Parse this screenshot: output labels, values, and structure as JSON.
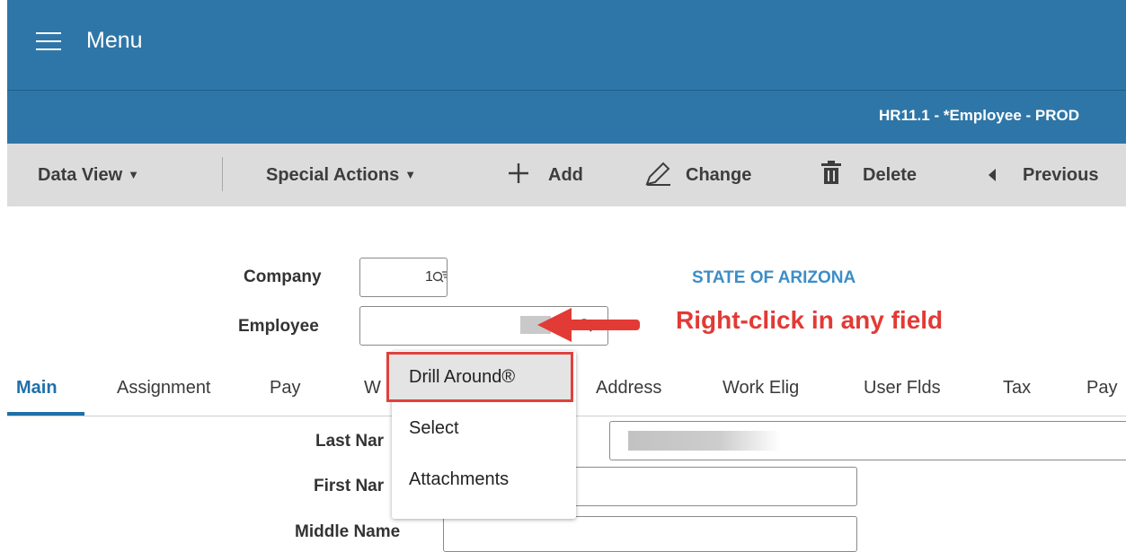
{
  "header": {
    "menu_label": "Menu"
  },
  "subheader": {
    "title": "HR11.1 - *Employee - PROD"
  },
  "toolbar": {
    "data_view": "Data View",
    "special_actions": "Special Actions",
    "add": "Add",
    "change": "Change",
    "delete": "Delete",
    "previous": "Previous"
  },
  "form": {
    "company_label": "Company",
    "company_value": "1",
    "employee_label": "Employee",
    "employee_value": "",
    "org_name": "STATE OF ARIZONA"
  },
  "annotation": {
    "text": "Right-click in any field"
  },
  "tabs": [
    {
      "label": "Main"
    },
    {
      "label": "Assignment"
    },
    {
      "label": "Pay"
    },
    {
      "label": "W"
    },
    {
      "label": "Address"
    },
    {
      "label": "Work Elig"
    },
    {
      "label": "User Flds"
    },
    {
      "label": "Tax"
    },
    {
      "label": "Pay"
    }
  ],
  "context_menu": {
    "items": [
      {
        "label": "Drill Around®"
      },
      {
        "label": "Select"
      },
      {
        "label": "Attachments"
      }
    ]
  },
  "main_fields": {
    "last_name_label": "Last Nar",
    "first_name_label": "First Nar",
    "middle_name_label": "Middle Name"
  },
  "colors": {
    "header_bg": "#2e76a7",
    "toolbar_bg": "#dcdcdc",
    "accent_blue": "#1f6fa8",
    "org_name": "#3d8dc6",
    "annotation_red": "#e23a35"
  }
}
